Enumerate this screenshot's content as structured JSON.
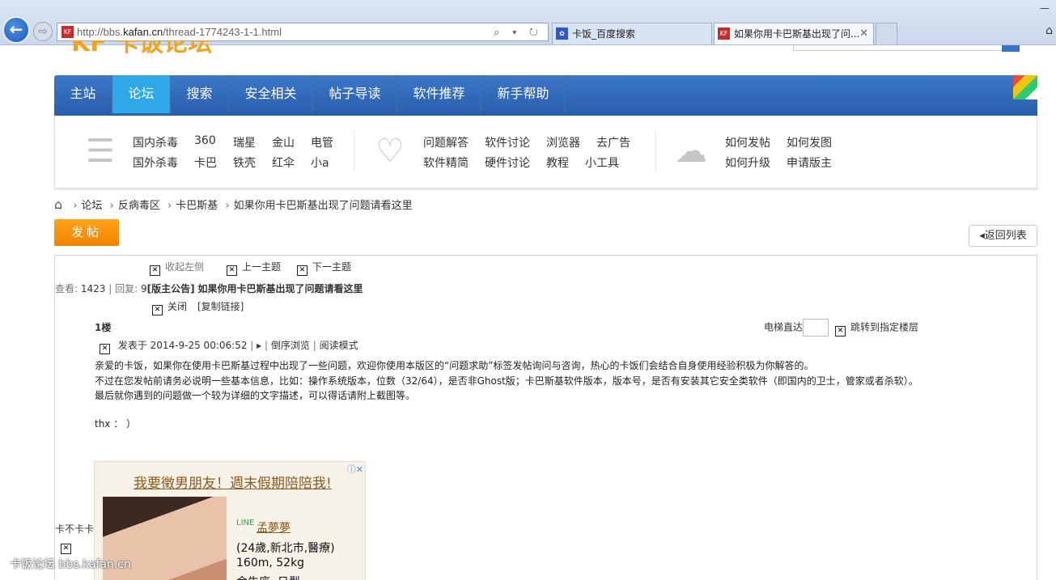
{
  "browser": {
    "url_prefix": "http://bbs.",
    "url_domain": "kafan.cn",
    "url_suffix": "/thread-1774243-1-1.html",
    "addr_icons": "⌕ ▾ ↻",
    "tabs": [
      {
        "label": "卡饭_百度搜索",
        "favicon": "✿"
      },
      {
        "label": "如果你用卡巴斯基出现了问...",
        "favicon": "KF",
        "close": "✕"
      }
    ],
    "back_glyph": "←",
    "forward_glyph": "⇨",
    "win_min": "—",
    "home_glyph": "⌂"
  },
  "site": {
    "logo": "KF 卡饭论坛"
  },
  "main_nav": [
    "主站",
    "论坛",
    "搜索",
    "安全相关",
    "帖子导读",
    "软件推荐",
    "新手帮助"
  ],
  "sub_nav": {
    "group1": [
      "国内杀毒",
      "360",
      "瑞星",
      "金山",
      "电管",
      "国外杀毒",
      "卡巴",
      "铁壳",
      "红伞",
      "小a"
    ],
    "group2": [
      "问题解答",
      "软件讨论",
      "浏览器",
      "去广告",
      "软件精简",
      "硬件讨论",
      "教程",
      "小工具"
    ],
    "group3": [
      "如何发帖",
      "如何发图",
      "如何升级",
      "申请版主"
    ]
  },
  "breadcrumb": [
    "论坛",
    "反病毒区",
    "卡巴斯基",
    "如果你用卡巴斯基出现了问题请看这里"
  ],
  "actions": {
    "post": "发帖",
    "back_list": "返回列表"
  },
  "thread": {
    "collapse": "收起左侧",
    "prev": "上一主题",
    "next": "下一主题",
    "views_label": "查看:",
    "views": "1423",
    "replies_label": "回复:",
    "replies": "9",
    "title_tag": "[版主公告]",
    "title": "如果你用卡巴斯基出现了问题请看这里",
    "close": "关闭",
    "copy_link": "[复制链接]",
    "floor": "1楼",
    "elevator": "电梯直达",
    "jump": "跳转到指定楼层",
    "posted_at": "发表于 2014-9-25 00:06:52",
    "reverse": "倒序浏览",
    "read_mode": "阅读模式",
    "body": [
      "亲爱的卡饭，如果你在使用卡巴斯基过程中出现了一些问题，欢迎你使用本版区的“问题求助”标签发帖询问与咨询，热心的卡饭们会结合自身使用经验积极为你解答的。",
      "不过在您发帖前请务必说明一些基本信息，比如：操作系统版本，位数（32/64），是否非Ghost版；卡巴斯基软件版本，版本号，是否有安装其它安全类软件（即国内的卫士，管家或者杀软）。",
      "最后就你遇到的问题做一个较为详细的文字描述，可以得话请附上截图等。"
    ],
    "thanks": "thx ： ）",
    "sidebar_user": "卡不卡卡"
  },
  "ad": {
    "title": "我要徵男朋友！週末假期陪陪我!",
    "close_icons": "ⓘ✕",
    "line_label": "LINE",
    "name": "孟夢夢",
    "line1": "(24歲,新北市,醫療)",
    "line2": "160m, 52kg",
    "line3": "金牛座, 日型"
  },
  "watermark": "卡饭论坛 bbs.kafan.cn",
  "colors": {
    "nav_blue": "#2a5fae",
    "nav_active": "#2ea8e6",
    "orange": "#f08300"
  }
}
